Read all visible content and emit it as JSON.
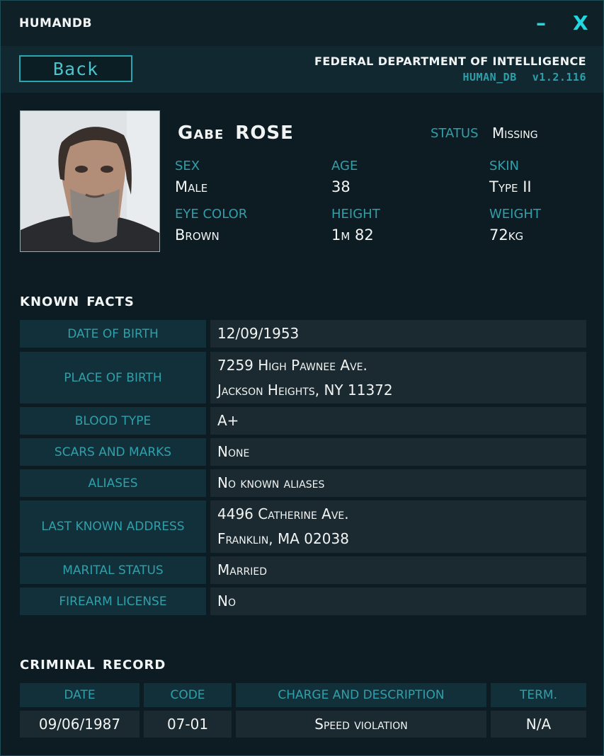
{
  "window": {
    "title": "HUMANDB",
    "minimize_glyph": "–",
    "close_glyph": "X"
  },
  "header": {
    "back_label": "Back",
    "agency": "FEDERAL DEPARTMENT OF INTELLIGENCE",
    "db_name": "HUMAN_DB",
    "version": "v1.2.116"
  },
  "profile": {
    "first_name": "Gabe",
    "last_name": "ROSE",
    "status_label": "STATUS",
    "status_value": "Missing",
    "attributes": [
      {
        "label": "SEX",
        "value": "Male"
      },
      {
        "label": "AGE",
        "value": "38"
      },
      {
        "label": "SKIN",
        "value": "Type II"
      },
      {
        "label": "EYE COLOR",
        "value": "Brown"
      },
      {
        "label": "HEIGHT",
        "value": "1m 82"
      },
      {
        "label": "WEIGHT",
        "value": "72kg"
      }
    ]
  },
  "known_facts": {
    "title_1": "KNOWN",
    "title_2": "FACTS",
    "rows": [
      {
        "label": "DATE OF BIRTH",
        "line1": "12/09/1953",
        "line2": ""
      },
      {
        "label": "PLACE OF BIRTH",
        "line1": "7259 High Pawnee Ave.",
        "line2": "Jackson Heights, NY 11372"
      },
      {
        "label": "BLOOD TYPE",
        "line1": "A+",
        "line2": ""
      },
      {
        "label": "SCARS AND MARKS",
        "line1": "None",
        "line2": ""
      },
      {
        "label": "ALIASES",
        "line1": "No known aliases",
        "line2": ""
      },
      {
        "label": "LAST KNOWN ADDRESS",
        "line1": "4496 Catherine Ave.",
        "line2": "Franklin, MA 02038"
      },
      {
        "label": "MARITAL STATUS",
        "line1": "Married",
        "line2": ""
      },
      {
        "label": "FIREARM LICENSE",
        "line1": "No",
        "line2": ""
      }
    ]
  },
  "criminal_record": {
    "title_1": "CRIMINAL",
    "title_2": "RECORD",
    "headers": [
      "DATE",
      "CODE",
      "CHARGE AND DESCRIPTION",
      "TERM."
    ],
    "rows": [
      {
        "date": "09/06/1987",
        "code": "07-01",
        "charge": "Speed violation",
        "term": "N/A"
      }
    ]
  },
  "colors": {
    "accent": "#23d7e0",
    "label": "#2fa0aa",
    "background": "#0d1c23"
  }
}
